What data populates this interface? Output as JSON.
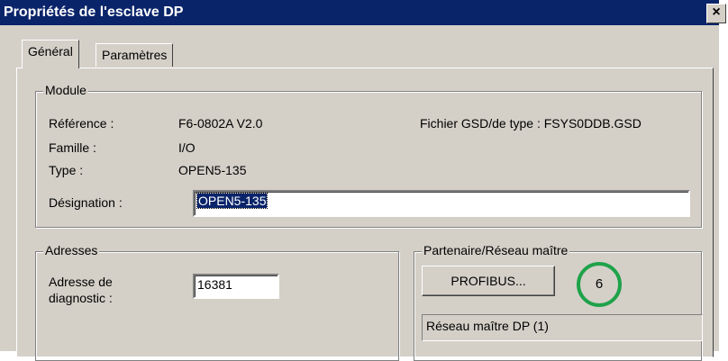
{
  "window": {
    "title": "Propriétés de l'esclave DP",
    "close_glyph": "×"
  },
  "tabs": [
    {
      "label": "Général",
      "active": true
    },
    {
      "label": "Paramètres",
      "active": false
    }
  ],
  "module": {
    "legend": "Module",
    "reference_label": "Référence :",
    "reference_value": "F6-0802A V2.0",
    "gsd_text": "Fichier GSD/de type : FSYS0DDB.GSD",
    "family_label": "Famille :",
    "family_value": "I/O",
    "type_label": "Type :",
    "type_value": "OPEN5-135",
    "designation_label": "Désignation :",
    "designation_value": "OPEN5-135"
  },
  "addresses": {
    "legend": "Adresses",
    "diag_label_line1": "Adresse de",
    "diag_label_line2": "diagnostic :",
    "diag_value": "16381"
  },
  "partner": {
    "legend": "Partenaire/Réseau maître",
    "profibus_button": "PROFIBUS...",
    "marker_number": "6",
    "network_text": "Réseau maître DP (1)"
  },
  "colors": {
    "title_bar": "#0a246a",
    "marker": "#1fa24a",
    "dialog": "#d4d0c8"
  }
}
